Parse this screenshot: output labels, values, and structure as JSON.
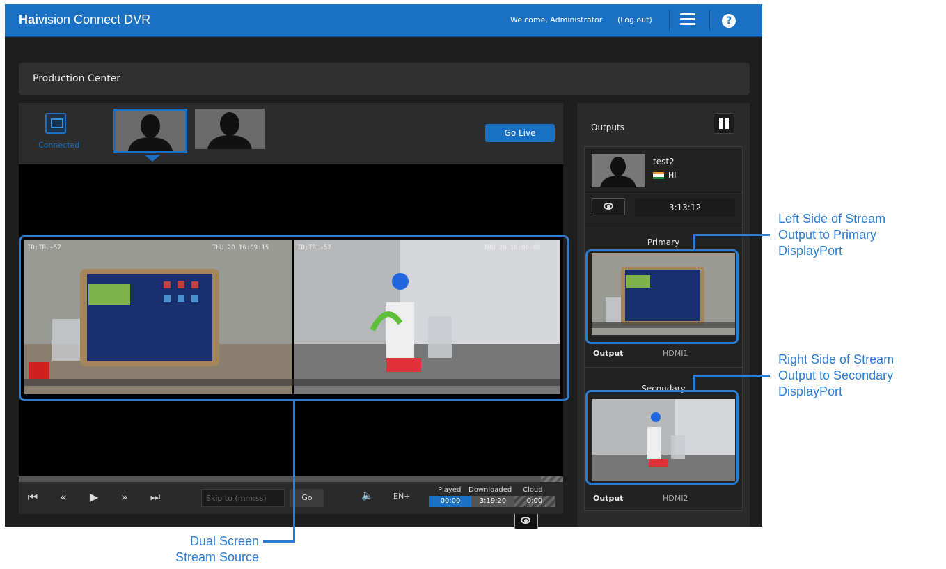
{
  "app": {
    "brand_bold": "Hai",
    "brand_rest": "vision Connect DVR",
    "welcome": "Welcome, Administrator",
    "logout": "(Log out)"
  },
  "production": {
    "title": "Production Center",
    "connected_label": "Connected",
    "go_live": "Go Live"
  },
  "controls": {
    "skip_placeholder": "Skip to (mm:ss)",
    "go": "Go",
    "lang": "EN+",
    "played_label": "Played",
    "downloaded_label": "Downloaded",
    "cloud_label": "Cloud",
    "played": "00:00",
    "downloaded": "3:19:20",
    "cloud": "0:00"
  },
  "outputs": {
    "title": "Outputs",
    "source_name": "test2",
    "lang": "HI",
    "time": "3:13:12",
    "primary_label": "Primary",
    "secondary_label": "Secondary",
    "output_label": "Output",
    "primary_port": "HDMI1",
    "secondary_port": "HDMI2"
  },
  "annotations": {
    "left_line1": "Left Side of Stream",
    "left_line2": "Output to Primary",
    "left_line3": "DisplayPort",
    "right_line1": "Right Side of Stream",
    "right_line2": "Output to Secondary",
    "right_line3": "DisplayPort",
    "dual_line1": "Dual Screen",
    "dual_line2": "Stream Source"
  },
  "colors": {
    "accent": "#1a70c2",
    "annotation": "#2b7cd3"
  }
}
